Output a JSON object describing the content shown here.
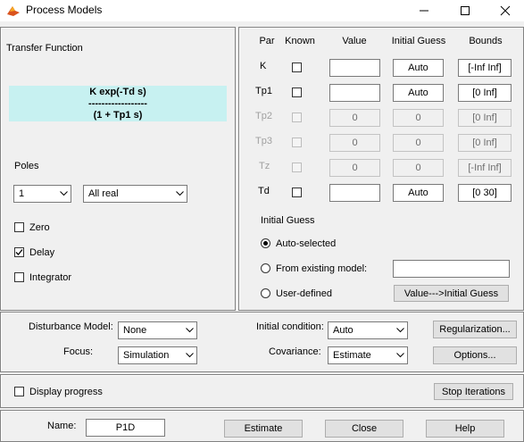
{
  "window": {
    "title": "Process Models",
    "icon": "matlab-icon"
  },
  "transfer_function": {
    "label": "Transfer Function",
    "numerator": "K exp(-Td s)",
    "divider": "------------------",
    "denominator": "(1 + Tp1 s)"
  },
  "poles": {
    "label": "Poles",
    "count": "1",
    "type": "All real"
  },
  "options": {
    "zero": "Zero",
    "delay": "Delay",
    "integrator": "Integrator",
    "zero_checked": false,
    "delay_checked": true,
    "integrator_checked": false
  },
  "table": {
    "headers": {
      "par": "Par",
      "known": "Known",
      "value": "Value",
      "initial_guess": "Initial Guess",
      "bounds": "Bounds"
    },
    "rows": [
      {
        "par": "K",
        "value": "",
        "guess": "Auto",
        "bounds": "[-Inf Inf]",
        "enabled": true
      },
      {
        "par": "Tp1",
        "value": "",
        "guess": "Auto",
        "bounds": "[0 Inf]",
        "enabled": true
      },
      {
        "par": "Tp2",
        "value": "0",
        "guess": "0",
        "bounds": "[0 Inf]",
        "enabled": false
      },
      {
        "par": "Tp3",
        "value": "0",
        "guess": "0",
        "bounds": "[0 Inf]",
        "enabled": false
      },
      {
        "par": "Tz",
        "value": "0",
        "guess": "0",
        "bounds": "[-Inf Inf]",
        "enabled": false
      },
      {
        "par": "Td",
        "value": "",
        "guess": "Auto",
        "bounds": "[0 30]",
        "enabled": true
      }
    ]
  },
  "initial_guess": {
    "label": "Initial Guess",
    "auto": "Auto-selected",
    "existing": "From existing model:",
    "existing_value": "",
    "user": "User-defined",
    "value_button": "Value--->Initial Guess",
    "selected": "auto"
  },
  "settings": {
    "disturbance_label": "Disturbance Model:",
    "disturbance_value": "None",
    "focus_label": "Focus:",
    "focus_value": "Simulation",
    "initial_condition_label": "Initial condition:",
    "initial_condition_value": "Auto",
    "covariance_label": "Covariance:",
    "covariance_value": "Estimate",
    "regularization_button": "Regularization...",
    "options_button": "Options..."
  },
  "progress": {
    "display_label": "Display progress",
    "checked": false,
    "stop_button": "Stop Iterations"
  },
  "footer": {
    "name_label": "Name:",
    "name_value": "P1D",
    "estimate_button": "Estimate",
    "close_button": "Close",
    "help_button": "Help"
  }
}
